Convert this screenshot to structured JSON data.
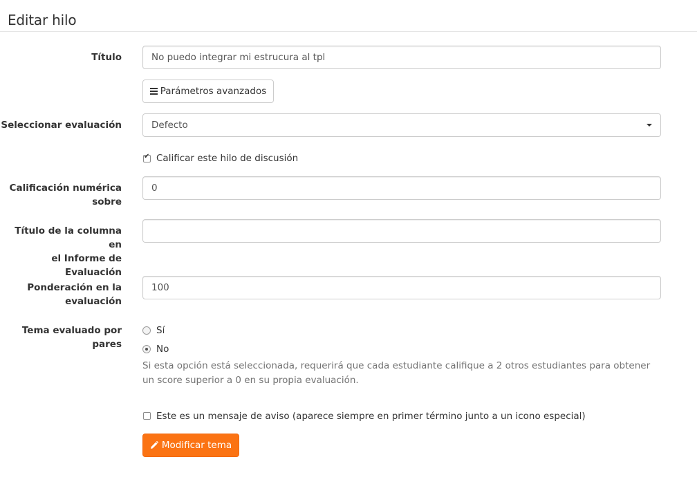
{
  "page": {
    "title": "Editar hilo"
  },
  "form": {
    "title_label": "Título",
    "title_value": "No puedo integrar mi estrucura al tpl",
    "advanced_button": "Parámetros avanzados",
    "evaluation_label": "Seleccionar evaluación",
    "evaluation_selected": "Defecto",
    "qualify_checkbox_label": "Calificar este hilo de discusión",
    "qualify_checked": true,
    "numeric_label_line1": "Calificación numérica",
    "numeric_label_line2": "sobre",
    "numeric_value": "0",
    "column_title_label_line1": "Título de la columna en",
    "column_title_label_line2": "el Informe de",
    "column_title_label_line3": "Evaluación",
    "column_title_value": "",
    "weight_label_line1": "Ponderación en la",
    "weight_label_line2": "evaluación",
    "weight_value": "100",
    "peer_label_line1": "Tema evaluado por",
    "peer_label_line2": "pares",
    "peer_options": [
      {
        "label": "Sí",
        "selected": false
      },
      {
        "label": "No",
        "selected": true
      }
    ],
    "peer_help": "Si esta opción está seleccionada, requerirá que cada estudiante califique a 2 otros estudiantes para obtener un score superior a 0 en su propia evaluación.",
    "sticky_checkbox_label": "Este es un mensaje de aviso (aparece siempre en primer término junto a un icono especial)",
    "sticky_checked": false,
    "submit_button": "Modificar tema"
  },
  "colors": {
    "accent": "#fb7313",
    "border": "#cccccc",
    "help_text": "#737373"
  },
  "icons": {
    "advanced": "bars-icon",
    "select": "caret-down-icon",
    "submit": "pencil-icon"
  }
}
